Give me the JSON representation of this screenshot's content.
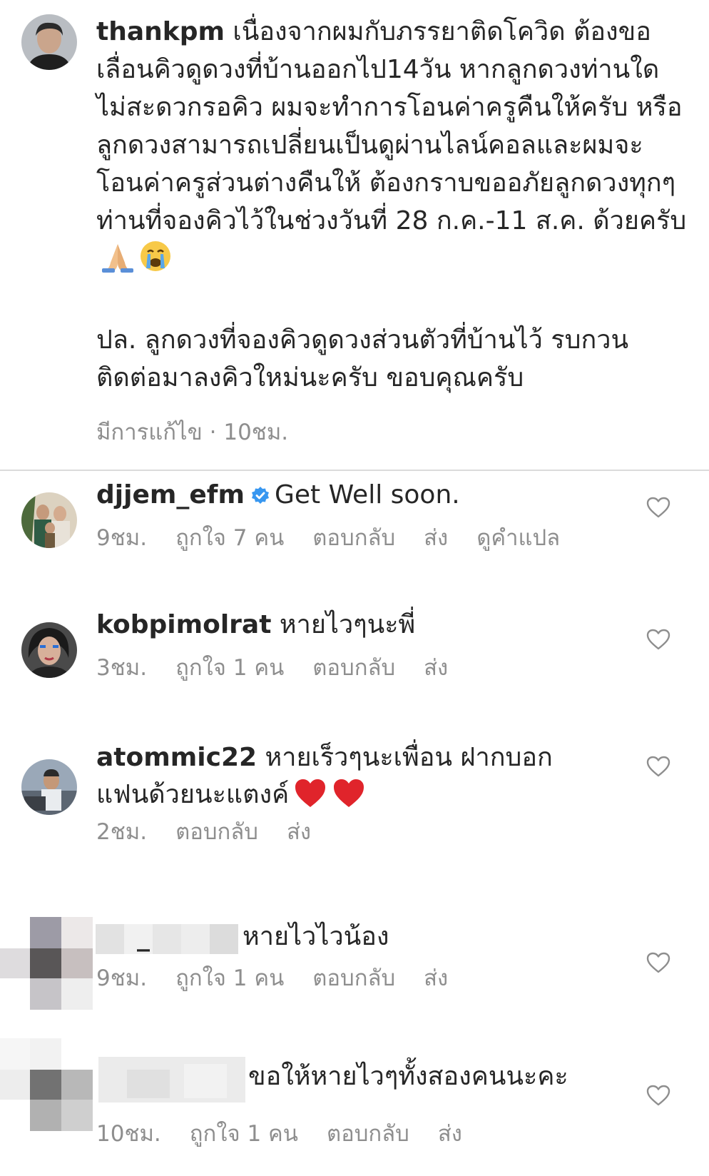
{
  "caption": {
    "username": "thankpm",
    "text": " เนื่องจากผมกับภรรยาติดโควิด ต้องขอเลื่อนคิวดูดวงที่บ้านออกไป14วัน หากลูกดวงท่านใดไม่สะดวกรอคิว ผมจะทำการโอนค่าครูคืนให้ครับ หรือ ลูกดวงสามารถเปลี่ยนเป็นดูผ่านไลน์คอลและผมจะโอนค่าครูส่วนต่างคืนให้ ต้องกราบขออภัยลูกดวงทุกๆท่านที่จองคิวไว้ในช่วงวันที่ 28 ก.ค.-11 ส.ค. ด้วยครับ",
    "emojis": [
      "folded-hands",
      "crying-face"
    ],
    "postscript": "ปล. ลูกดวงที่จองคิวดูดวงส่วนตัวที่บ้านไว้ รบกวนติดต่อมาลงคิวใหม่นะครับ ขอบคุณครับ",
    "meta": "มีการแก้ไข · 10ชม."
  },
  "comments": [
    {
      "username": "djjem_efm",
      "verified": true,
      "text": "Get Well soon.",
      "time": "9ชม.",
      "likes": "ถูกใจ 7 คน",
      "reply": "ตอบกลับ",
      "send": "ส่ง",
      "translate": "ดูคำแปล"
    },
    {
      "username": "kobpimolrat",
      "text": "หายไวๆนะพี่",
      "time": "3ชม.",
      "likes": "ถูกใจ 1 คน",
      "reply": "ตอบกลับ",
      "send": "ส่ง"
    },
    {
      "username": "atommic22",
      "text": "หายเร็วๆนะเพื่อน ฝากบอกแฟนด้วยนะแตงค์",
      "emojis": [
        "red-heart",
        "red-heart"
      ],
      "time": "2ชม.",
      "reply": "ตอบกลับ",
      "send": "ส่ง"
    },
    {
      "username": "_",
      "text": "หายไวไวน้อง",
      "time": "9ชม.",
      "likes": "ถูกใจ 1 คน",
      "reply": "ตอบกลับ",
      "send": "ส่ง"
    },
    {
      "username": "",
      "text": "ขอให้หายไวๆทั้งสองคนนะคะ",
      "time": "10ชม.",
      "likes": "ถูกใจ 1 คน",
      "reply": "ตอบกลับ",
      "send": "ส่ง"
    }
  ],
  "colors": {
    "text": "#262626",
    "meta": "#8e8e8e",
    "verified": "#3897f0",
    "divider": "#dbdbdb",
    "heart_emoji": "#e0242b"
  }
}
